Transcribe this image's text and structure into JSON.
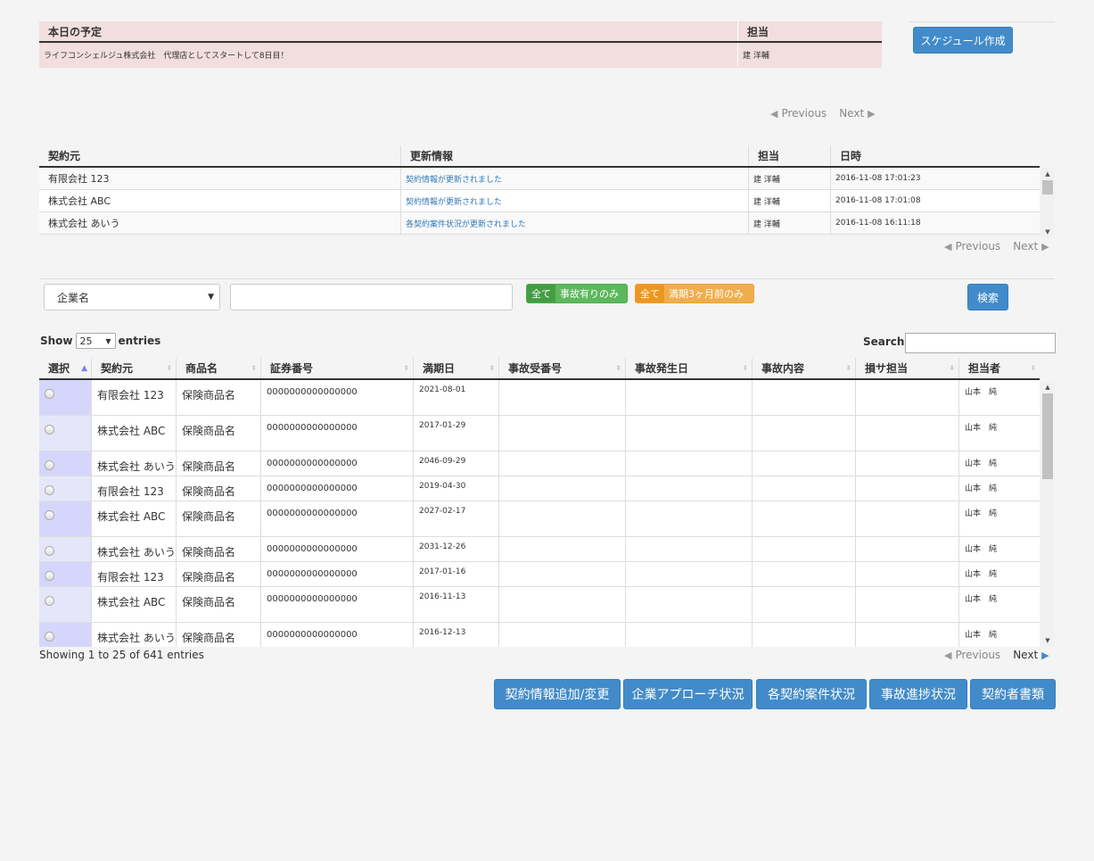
{
  "schedule": {
    "header_title": "本日の予定",
    "header_staff": "担当",
    "item_text": "ライフコンシェルジュ株式会社　代理店としてスタートして8日目！",
    "item_staff": "建 洋輔",
    "create_button": "スケジュール作成"
  },
  "pager": {
    "previous": "Previous",
    "next": "Next"
  },
  "updates": {
    "headers": [
      "契約元",
      "更新情報",
      "担当",
      "日時"
    ],
    "rows": [
      {
        "company": "有限会社 123",
        "info": "契約情報が更新されました",
        "staff": "建 洋輔",
        "datetime": "2016-11-08 17:01:23"
      },
      {
        "company": "株式会社 ABC",
        "info": "契約情報が更新されました",
        "staff": "建 洋輔",
        "datetime": "2016-11-08 17:01:08"
      },
      {
        "company": "株式会社 あいう",
        "info": "各契約案件状況が更新されました",
        "staff": "建 洋輔",
        "datetime": "2016-11-08 16:11:18"
      }
    ]
  },
  "filter": {
    "select_value": "企業名",
    "search_text": "",
    "toggle1": {
      "all": "全て",
      "option": "事故有りのみ"
    },
    "toggle2": {
      "all": "全て",
      "option": "満期3ヶ月前のみ"
    },
    "search_button": "検索"
  },
  "datatable": {
    "show_label": "Show",
    "entries_value": "25",
    "entries_label": "entries",
    "search_label": "Search:",
    "headers": [
      "選択",
      "契約元",
      "商品名",
      "証券番号",
      "満期日",
      "事故受番号",
      "事故発生日",
      "事故内容",
      "損サ担当",
      "担当者"
    ],
    "rows": [
      {
        "company": "有限会社 123",
        "product": "保険商品名",
        "policy": "0000000000000000",
        "expiry": "2021-08-01",
        "staff": "山本　純"
      },
      {
        "company": "株式会社 ABC",
        "product": "保険商品名",
        "policy": "0000000000000000",
        "expiry": "2017-01-29",
        "staff": "山本　純"
      },
      {
        "company": "株式会社 あいう",
        "product": "保険商品名",
        "policy": "0000000000000000",
        "expiry": "2046-09-29",
        "staff": "山本　純"
      },
      {
        "company": "有限会社 123",
        "product": "保険商品名",
        "policy": "0000000000000000",
        "expiry": "2019-04-30",
        "staff": "山本　純"
      },
      {
        "company": "株式会社 ABC",
        "product": "保険商品名",
        "policy": "0000000000000000",
        "expiry": "2027-02-17",
        "staff": "山本　純"
      },
      {
        "company": "株式会社 あいう",
        "product": "保険商品名",
        "policy": "0000000000000000",
        "expiry": "2031-12-26",
        "staff": "山本　純"
      },
      {
        "company": "有限会社 123",
        "product": "保険商品名",
        "policy": "0000000000000000",
        "expiry": "2017-01-16",
        "staff": "山本　純"
      },
      {
        "company": "株式会社 ABC",
        "product": "保険商品名",
        "policy": "0000000000000000",
        "expiry": "2016-11-13",
        "staff": "山本　純"
      },
      {
        "company": "株式会社 あいう",
        "product": "保険商品名",
        "policy": "0000000000000000",
        "expiry": "2016-12-13",
        "staff": "山本　純"
      }
    ],
    "info": "Showing 1 to 25 of 641 entries"
  },
  "actions": [
    "契約情報追加/変更",
    "企業アプローチ状況",
    "各契約案件状況",
    "事故進捗状況",
    "契約者書類"
  ],
  "colors": {
    "primary": "#428bca",
    "schedule_bg": "#f2dede",
    "success": "#5cb85c",
    "warning": "#f0ad4e"
  }
}
